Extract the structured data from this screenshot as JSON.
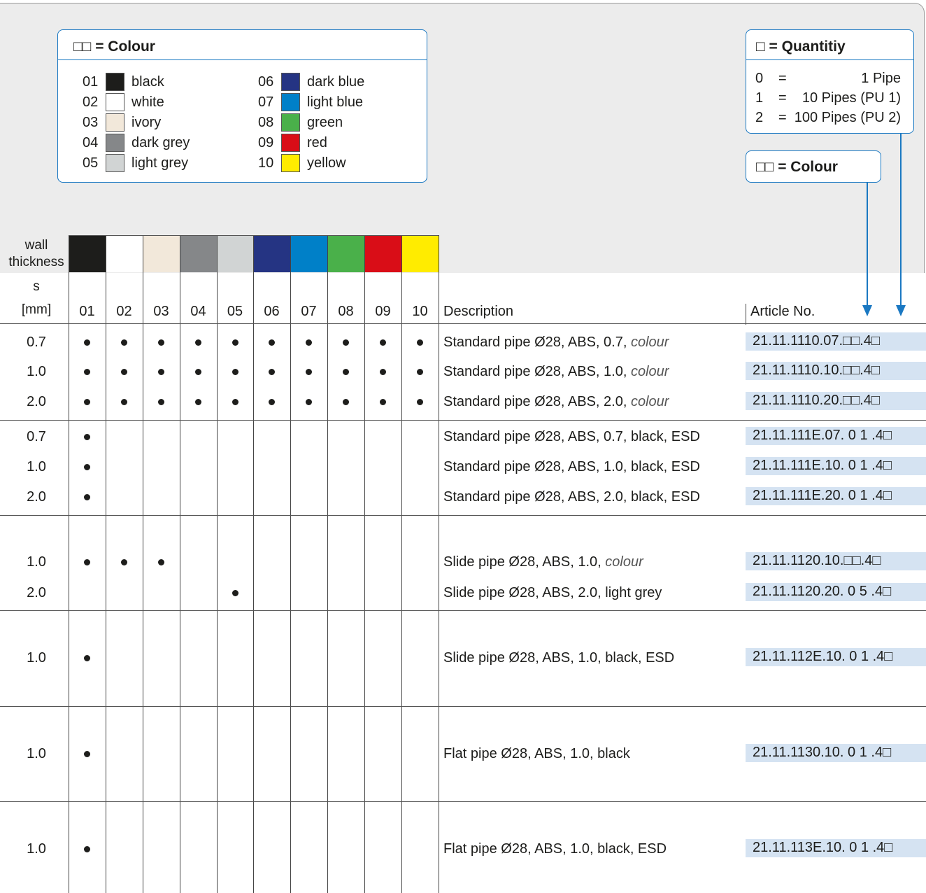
{
  "colour_box": {
    "title": "□□  =  Colour",
    "items": [
      {
        "code": "01",
        "name": "black",
        "color": "#1d1d1b"
      },
      {
        "code": "02",
        "name": "white",
        "color": "#ffffff"
      },
      {
        "code": "03",
        "name": "ivory",
        "color": "#f2e8da"
      },
      {
        "code": "04",
        "name": "dark grey",
        "color": "#858789"
      },
      {
        "code": "05",
        "name": "light grey",
        "color": "#d1d4d4"
      },
      {
        "code": "06",
        "name": "dark blue",
        "color": "#253483"
      },
      {
        "code": "07",
        "name": "light blue",
        "color": "#0080c8"
      },
      {
        "code": "08",
        "name": "green",
        "color": "#4ab04a"
      },
      {
        "code": "09",
        "name": "red",
        "color": "#d90d17"
      },
      {
        "code": "10",
        "name": "yellow",
        "color": "#ffec00"
      }
    ]
  },
  "quantity_box": {
    "title": "□  =  Quantitiy",
    "lines": [
      {
        "code": "0",
        "eq": "=",
        "text": "1 Pipe"
      },
      {
        "code": "1",
        "eq": "=",
        "text": "10 Pipes (PU 1)"
      },
      {
        "code": "2",
        "eq": "=",
        "text": "100 Pipes (PU 2)"
      }
    ]
  },
  "colour_key_box": {
    "title": "□□ = Colour"
  },
  "table": {
    "header": {
      "wall_line1": "wall",
      "wall_line2": "thickness",
      "s_label": "s",
      "mm_label": "[mm]",
      "codes": [
        "01",
        "02",
        "03",
        "04",
        "05",
        "06",
        "07",
        "08",
        "09",
        "10"
      ],
      "description": "Description",
      "article": "Article No."
    },
    "rows": [
      {
        "s": "0.7",
        "dots": [
          1,
          1,
          1,
          1,
          1,
          1,
          1,
          1,
          1,
          1
        ],
        "desc": "Standard pipe Ø28, ABS, 0.7, ",
        "desc_it": "colour",
        "art": "21.11.1110.07.□□.4□"
      },
      {
        "s": "1.0",
        "dots": [
          1,
          1,
          1,
          1,
          1,
          1,
          1,
          1,
          1,
          1
        ],
        "desc": "Standard pipe Ø28, ABS, 1.0, ",
        "desc_it": "colour",
        "art": "21.11.1110.10.□□.4□"
      },
      {
        "s": "2.0",
        "dots": [
          1,
          1,
          1,
          1,
          1,
          1,
          1,
          1,
          1,
          1
        ],
        "desc": "Standard pipe Ø28, ABS, 2.0, ",
        "desc_it": "colour",
        "art": "21.11.1110.20.□□.4□"
      },
      {
        "s": "0.7",
        "dots": [
          1,
          0,
          0,
          0,
          0,
          0,
          0,
          0,
          0,
          0
        ],
        "desc": "Standard pipe Ø28, ABS, 0.7, black, ESD",
        "desc_it": "",
        "art": "21.11.111E.07. 0 1 .4□"
      },
      {
        "s": "1.0",
        "dots": [
          1,
          0,
          0,
          0,
          0,
          0,
          0,
          0,
          0,
          0
        ],
        "desc": "Standard pipe Ø28, ABS, 1.0, black, ESD",
        "desc_it": "",
        "art": "21.11.111E.10. 0 1 .4□"
      },
      {
        "s": "2.0",
        "dots": [
          1,
          0,
          0,
          0,
          0,
          0,
          0,
          0,
          0,
          0
        ],
        "desc": "Standard pipe Ø28, ABS, 2.0, black, ESD",
        "desc_it": "",
        "art": "21.11.111E.20. 0 1 .4□"
      },
      {
        "s": "1.0",
        "dots": [
          1,
          1,
          1,
          0,
          0,
          0,
          0,
          0,
          0,
          0
        ],
        "desc": "Slide pipe Ø28, ABS, 1.0, ",
        "desc_it": "colour",
        "art": "21.11.1120.10.□□.4□"
      },
      {
        "s": "2.0",
        "dots": [
          0,
          0,
          0,
          0,
          1,
          0,
          0,
          0,
          0,
          0
        ],
        "desc": "Slide pipe Ø28, ABS, 2.0, light grey",
        "desc_it": "",
        "art": "21.11.1120.20. 0 5 .4□"
      },
      {
        "s": "1.0",
        "dots": [
          1,
          0,
          0,
          0,
          0,
          0,
          0,
          0,
          0,
          0
        ],
        "desc": "Slide pipe Ø28, ABS, 1.0, black, ESD",
        "desc_it": "",
        "art": "21.11.112E.10. 0 1 .4□"
      },
      {
        "s": "1.0",
        "dots": [
          1,
          0,
          0,
          0,
          0,
          0,
          0,
          0,
          0,
          0
        ],
        "desc": "Flat pipe Ø28, ABS, 1.0, black",
        "desc_it": "",
        "art": "21.11.1130.10. 0 1 .4□"
      },
      {
        "s": "1.0",
        "dots": [
          1,
          0,
          0,
          0,
          0,
          0,
          0,
          0,
          0,
          0
        ],
        "desc": "Flat pipe Ø28, ABS, 1.0, black, ESD",
        "desc_it": "",
        "art": "21.11.113E.10. 0 1 .4□"
      }
    ]
  }
}
